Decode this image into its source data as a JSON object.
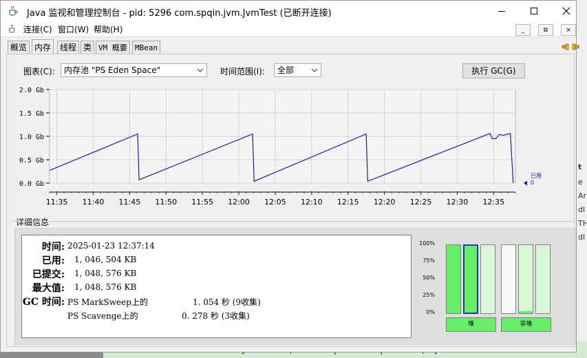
{
  "window": {
    "title": "Java 监视和管理控制台 - pid: 5296 com.spqin.jvm.JvmTest (已断开连接)",
    "minimize_icon": "minimize-icon",
    "maximize_icon": "maximize-icon",
    "close_icon": "close-icon"
  },
  "menubar": {
    "items": [
      "连接(C)",
      "窗口(W)",
      "帮助(H)"
    ],
    "mdi_buttons": [
      "_",
      "⧉",
      "×"
    ]
  },
  "tabs": [
    "概览",
    "内存",
    "线程",
    "类",
    "VM 概要",
    "MBean"
  ],
  "active_tab": "内存",
  "controls": {
    "chart_label": "图表(C):",
    "chart_value": "内存池 \"PS Eden Space\"",
    "range_label": "时间范围(I):",
    "range_value": "全部",
    "gc_button": "执行 GC(G)"
  },
  "chart_data": {
    "type": "line",
    "y_ticks": [
      "2.0 Gb",
      "1.5 Gb",
      "1.0 Gb",
      "0.5 Gb",
      "0.0 Gb"
    ],
    "ylim": [
      0,
      2.0
    ],
    "x_ticks": [
      "11:35",
      "11:40",
      "11:45",
      "11:50",
      "11:55",
      "12:00",
      "12:05",
      "12:10",
      "12:15",
      "12:20",
      "12:25",
      "12:30",
      "12:35"
    ],
    "xlim_minutes": [
      -1.0,
      63.0
    ],
    "series": [
      {
        "name": "已用",
        "color": "#1a1aaa",
        "points": [
          [
            -1.0,
            0.27
          ],
          [
            11.1,
            1.05
          ],
          [
            11.3,
            0.07
          ],
          [
            26.9,
            1.05
          ],
          [
            27.1,
            0.04
          ],
          [
            42.5,
            1.05
          ],
          [
            42.7,
            0.04
          ],
          [
            59.5,
            1.06
          ],
          [
            59.8,
            0.95
          ],
          [
            60.3,
            0.95
          ],
          [
            60.8,
            1.04
          ],
          [
            61.3,
            1.02
          ],
          [
            62.3,
            1.06
          ],
          [
            62.7,
            0.0
          ]
        ]
      }
    ],
    "legend": {
      "label": "已用",
      "value": "0"
    },
    "grid": true
  },
  "details": {
    "title": "详细信息",
    "time_label": "时间:",
    "time_value": "2025-01-23 12:37:14",
    "used_label": "已用:",
    "used_value": "1, 046, 504 KB",
    "committed_label": "已提交:",
    "committed_value": "1, 048, 576 KB",
    "max_label": "最大值:",
    "max_value": "1, 048, 576 KB",
    "gc_label": "GC 时间:",
    "gc1_name": "PS MarkSweep上的",
    "gc1_value": "1. 054 秒 (9收集)",
    "gc2_name": "PS Scavenge上的",
    "gc2_value": "0. 278 秒 (3收集)"
  },
  "pool_bars": {
    "pct_labels": [
      "100%",
      "75%",
      "50%",
      "25%",
      "0%"
    ],
    "heap_label": "堆",
    "nonheap_label": "非堆",
    "heap": [
      {
        "used": 1.0,
        "committed": 1.0
      },
      {
        "used": 1.0,
        "committed": 1.0,
        "selected": true
      },
      {
        "used": 0.0,
        "committed": 1.0
      }
    ],
    "nonheap": [
      {
        "used": 0.0,
        "committed": 0.0
      },
      {
        "used": 0.03,
        "committed": 1.0
      },
      {
        "used": 0.0,
        "committed": 1.0
      }
    ]
  },
  "background": {
    "right_fragments": [
      "t",
      "e",
      "Ar",
      "dl",
      "TH",
      "dl"
    ],
    "bottom_code": "} catch (InterruptedException e) {"
  }
}
